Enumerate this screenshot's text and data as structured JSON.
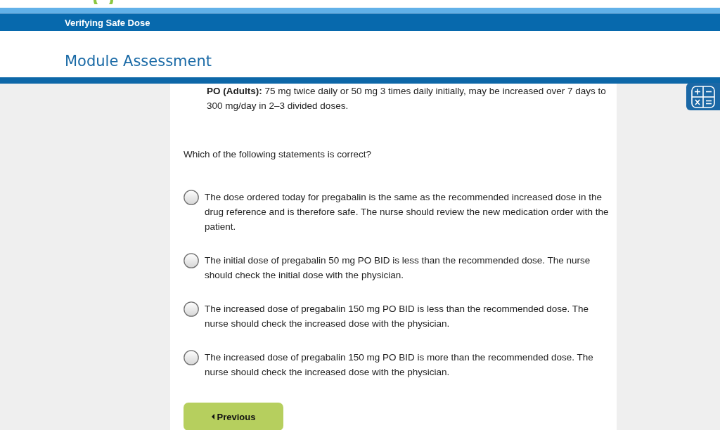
{
  "header": {
    "course_title": "Verifying Safe Dose",
    "page_title": "Module Assessment"
  },
  "reference": {
    "text": "**PO (Adults):** 75 mg twice daily or 50 mg 3 times daily initially, may be increased over 7 days to 300 mg/day in 2–3 divided doses."
  },
  "question": "Which of the following statements is correct?",
  "options": [
    {
      "text": "The dose ordered today for pregabalin is the same as the recommended increased dose in the drug reference and is therefore safe. The nurse should review the new medication order with the patient.",
      "selected": false
    },
    {
      "text": "The initial dose of pregabalin 50 mg PO BID is less than the recommended dose. The nurse should check the initial dose with the physician.",
      "selected": false
    },
    {
      "text": "The increased dose of pregabalin 150 mg PO BID is less than the recommended dose. The nurse should check the increased dose with the physician.",
      "selected": false
    },
    {
      "text": "The increased dose of pregabalin 150 mg PO BID is more than the recommended dose. The nurse should check the increased dose with the physician.",
      "selected": false
    }
  ],
  "buttons": [
    {
      "label": "Previous",
      "kind": "back"
    }
  ]
}
